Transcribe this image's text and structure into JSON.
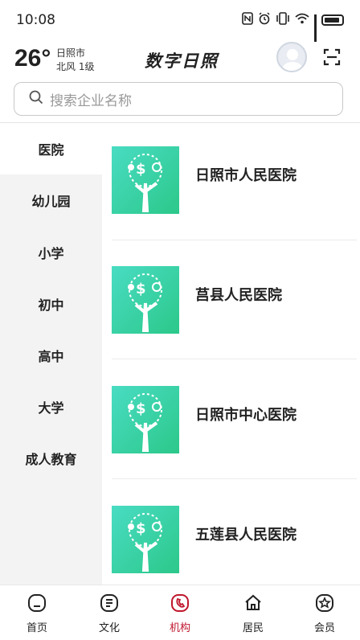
{
  "status_bar": {
    "time": "10:08",
    "icons": [
      "nfc-icon",
      "alarm-icon",
      "vibrate-icon",
      "wifi-icon",
      "signal-icon",
      "battery-icon"
    ]
  },
  "header": {
    "temperature": "26°",
    "city": "日照市",
    "wind": "北风  1级",
    "brand": "数字日照"
  },
  "search": {
    "placeholder": "搜索企业名称"
  },
  "sidebar": {
    "items": [
      {
        "label": "医院",
        "active": true
      },
      {
        "label": "幼儿园",
        "active": false
      },
      {
        "label": "小学",
        "active": false
      },
      {
        "label": "初中",
        "active": false
      },
      {
        "label": "高中",
        "active": false
      },
      {
        "label": "大学",
        "active": false
      },
      {
        "label": "成人教育",
        "active": false
      }
    ]
  },
  "list": {
    "items": [
      {
        "name": "日照市人民医院"
      },
      {
        "name": "莒县人民医院"
      },
      {
        "name": "日照市中心医院"
      },
      {
        "name": "五莲县人民医院"
      }
    ]
  },
  "bottom_nav": {
    "items": [
      {
        "label": "首页",
        "icon": "home-icon",
        "active": false
      },
      {
        "label": "文化",
        "icon": "culture-icon",
        "active": false
      },
      {
        "label": "机构",
        "icon": "institution-icon",
        "active": true
      },
      {
        "label": "居民",
        "icon": "resident-icon",
        "active": false
      },
      {
        "label": "会员",
        "icon": "member-icon",
        "active": false
      }
    ]
  },
  "colors": {
    "accent": "#c0172e",
    "thumb_gradient_start": "#49dcc3",
    "thumb_gradient_end": "#2cc88a",
    "sidebar_bg": "#f3f3f3"
  }
}
